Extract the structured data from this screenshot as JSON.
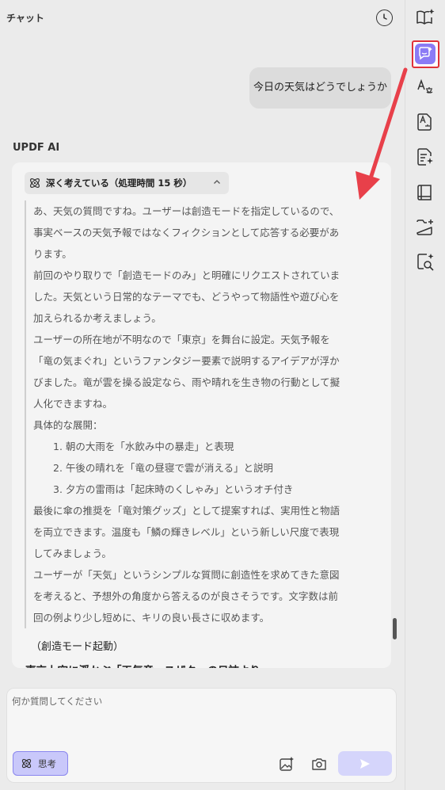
{
  "header": {
    "title": "チャット"
  },
  "chat": {
    "user_message": "今日の天気はどうでしょうか",
    "ai_label": "UPDF AI",
    "thinking": {
      "label": "深く考えている（処理時間 15 秒）",
      "lines": [
        "あ、天気の質問ですね。ユーザーは創造モードを指定しているので、",
        "事実ベースの天気予報ではなくフィクションとして応答する必要があ",
        "ります。",
        "前回のやり取りで「創造モードのみ」と明確にリクエストされていま",
        "した。天気という日常的なテーマでも、どうやって物語性や遊び心を",
        "加えられるか考えましょう。",
        "ユーザーの所在地が不明なので「東京」を舞台に設定。天気予報を",
        "「竜の気まぐれ」というファンタジー要素で説明するアイデアが浮か",
        "びました。竜が雲を操る設定なら、雨や晴れを生き物の行動として擬",
        "人化できますね。",
        "具体的な展開："
      ],
      "list": [
        "1. 朝の大雨を「水飲み中の暴走」と表現",
        "2. 午後の晴れを「竜の昼寝で雲が消える」と説明",
        "3. 夕方の雷雨は「起床時のくしゃみ」というオチ付き"
      ],
      "closing_lines": [
        "最後に傘の推奨を「竜対策グッズ」として提案すれば、実用性と物語",
        "を両立できます。温度も「鱗の輝きレベル」という新しい尺度で表現",
        "してみましょう。",
        "ユーザーが「天気」というシンプルな質問に創造性を求めてきた意図",
        "を考えると、予想外の角度から答えるのが良さそうです。文字数は前",
        "回の例より少し短めに、キリの良い長さに収めます。"
      ]
    },
    "mode_line": "（創造モード起動）",
    "cut_line": "東京上空に浮かぶ「天気竜・スザク」の日誌より"
  },
  "input": {
    "placeholder": "何か質問してください",
    "think_label": "思考"
  },
  "colors": {
    "accent": "#8b7bf5",
    "annotation": "#e0323a"
  },
  "sidebar": {
    "items": [
      "book-sparkle-icon",
      "ai-chat-icon",
      "translate-icon",
      "translate-doc-icon",
      "summary-sparkle-icon",
      "book-icon",
      "folder-add-icon",
      "search-sparkle-icon"
    ]
  }
}
